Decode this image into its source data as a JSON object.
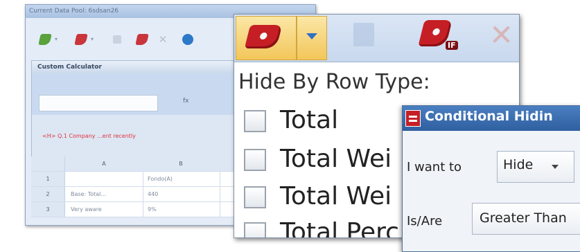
{
  "data_window": {
    "title": "Current Data Pool: 6sdsan26",
    "panel_title": "Custom Calculator",
    "fx_label": "fx",
    "warning_text": "<H> Q.1 Company ...ent recently",
    "grid_headers": [
      "A",
      "B"
    ],
    "grid_rows": [
      {
        "num": "1",
        "a": "",
        "b": "Fondo(A)"
      },
      {
        "num": "2",
        "a": "Base: Total...",
        "b": "440"
      },
      {
        "num": "3",
        "a": "Very aware",
        "b": "9%"
      }
    ]
  },
  "hide_menu": {
    "heading": "Hide By Row Type:",
    "options": [
      {
        "label": "Total",
        "checked": false
      },
      {
        "label": "Total Wei",
        "checked": false
      },
      {
        "label": "Total Wei",
        "checked": false
      },
      {
        "label": "Total Perc",
        "checked": false
      }
    ],
    "if_badge": "IF"
  },
  "conditional_dialog": {
    "title": "Conditional Hidin",
    "i_want_to_label": "I want to",
    "action_value": "Hide",
    "is_are_label": "Is/Are",
    "condition_value": "Greater Than"
  },
  "colors": {
    "accent_red": "#c51f25",
    "highlight_yellow": "#f2c65a",
    "dialog_title_blue": "#2f5f9f"
  }
}
